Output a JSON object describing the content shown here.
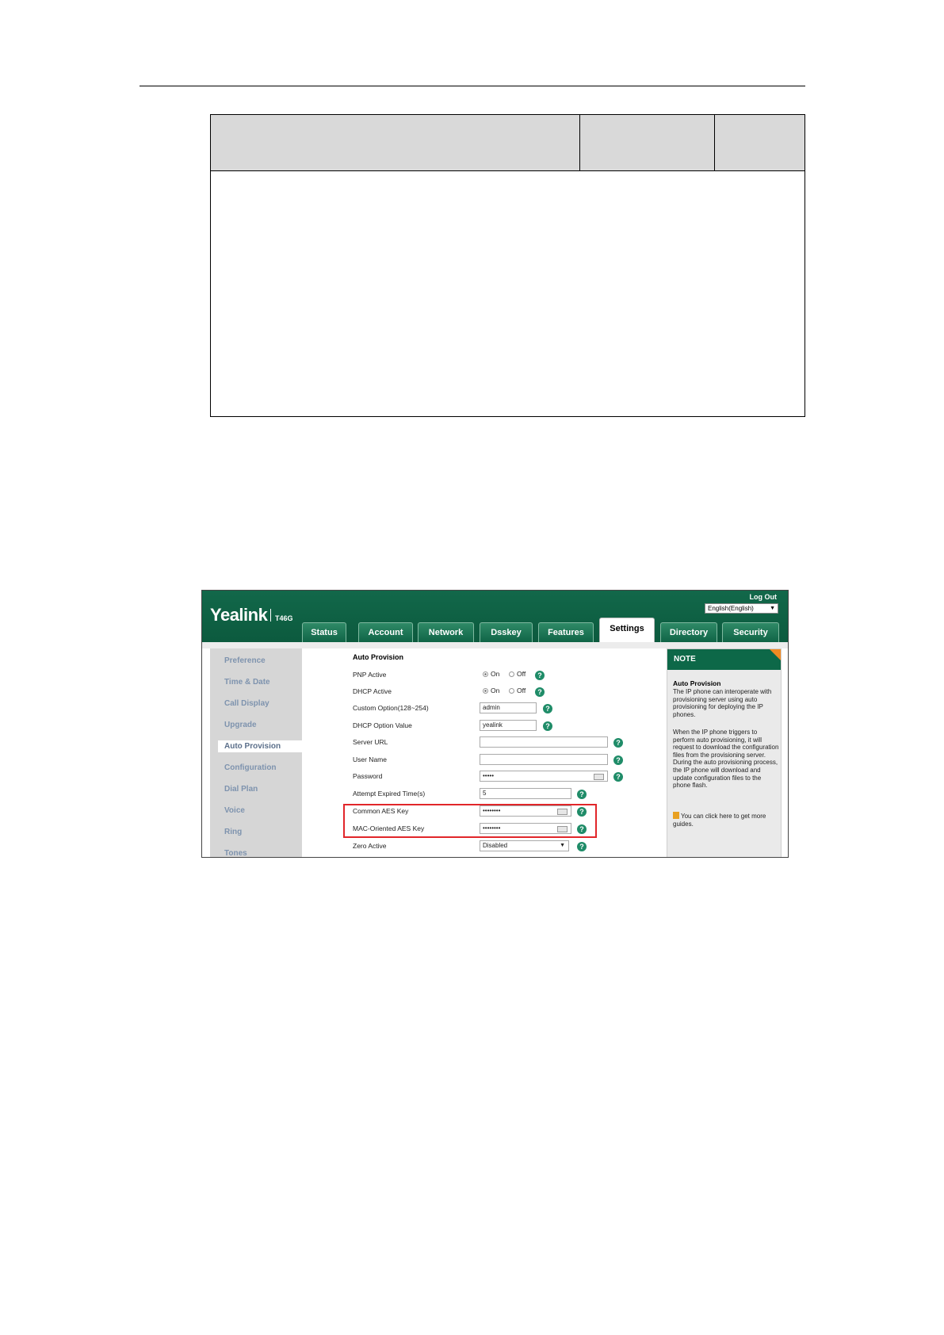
{
  "app": {
    "logo": "Yealink",
    "model": "T46G",
    "logout": "Log Out",
    "language": "English(English)"
  },
  "tabs": [
    "Status",
    "Account",
    "Network",
    "Dsskey",
    "Features",
    "Settings",
    "Directory",
    "Security"
  ],
  "sidebar": [
    "Preference",
    "Time & Date",
    "Call Display",
    "Upgrade",
    "Auto Provision",
    "Configuration",
    "Dial Plan",
    "Voice",
    "Ring",
    "Tones"
  ],
  "form": {
    "section_title": "Auto Provision",
    "pnp_label": "PNP Active",
    "dhcp_label": "DHCP Active",
    "radio_on": "On",
    "radio_off": "Off",
    "custom_option_label": "Custom Option(128~254)",
    "custom_option_value": "admin",
    "dhcp_value_label": "DHCP Option Value",
    "dhcp_value_value": "yealink",
    "server_url_label": "Server URL",
    "server_url_value": "",
    "user_name_label": "User Name",
    "user_name_value": "",
    "password_label": "Password",
    "password_value": "•••••",
    "attempt_label": "Attempt Expired Time(s)",
    "attempt_value": "5",
    "common_aes_label": "Common AES Key",
    "common_aes_value": "••••••••",
    "mac_aes_label": "MAC-Oriented AES Key",
    "mac_aes_value": "••••••••",
    "zero_label": "Zero Active",
    "zero_value": "Disabled",
    "help_glyph": "?"
  },
  "note": {
    "heading": "NOTE",
    "title": "Auto Provision",
    "p1": "The IP phone can interoperate with provisioning server using auto provisioning for deploying the IP phones.",
    "p2": "When the IP phone triggers to perform auto provisioning, it will request to download the configuration files from the provisioning server. During the auto provisioning process, the IP phone will download and update configuration files to the phone flash.",
    "p3": "You can click here to get more guides."
  },
  "colors": {
    "header_green": "#0c5a3e",
    "highlight_red": "#e1262a",
    "note_corner": "#f08a23"
  }
}
